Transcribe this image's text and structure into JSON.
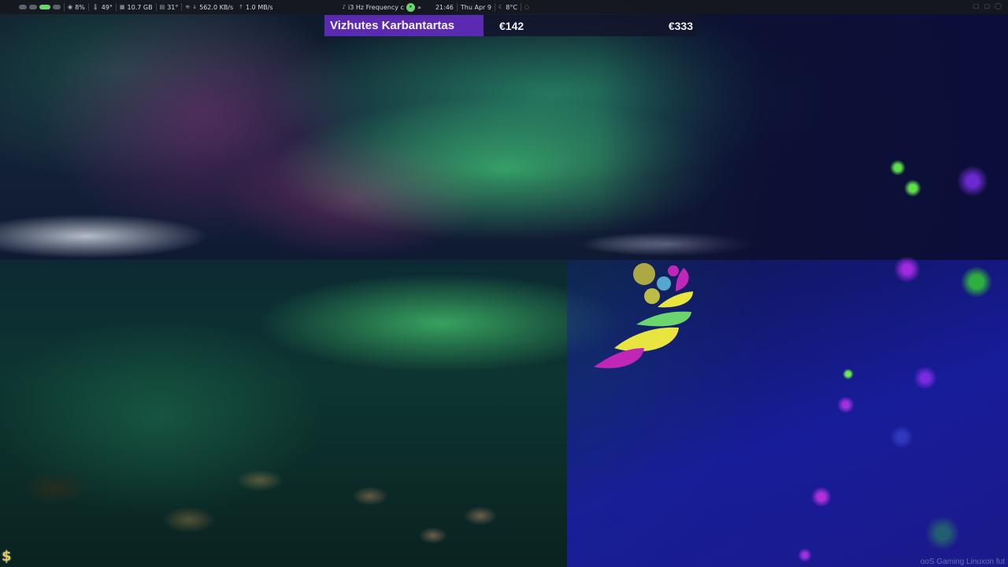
{
  "topbar": {
    "cpu": "8%",
    "cpu_temp": "49°",
    "memory": "10.7 GB",
    "gpu_temp": "31°",
    "net_down": "562.0 KB/s",
    "net_up": "1.0 MB/s",
    "media_title": "i3 Hz Frequency c",
    "media_next": "»",
    "clock": "21:46",
    "date": "Thu Apr 9",
    "weather": "8°C",
    "icons": [
      "cpu-icon",
      "thermometer-icon",
      "memory-icon",
      "gpu-icon",
      "wifi-icon",
      "arrow-down-icon",
      "arrow-up-icon",
      "music-icon",
      "moon-icon"
    ]
  },
  "ticker": {
    "name": "Vizhutes Karbantartas",
    "value_1": "€142",
    "value_2": "€333",
    "accent": "#5a2bb0"
  },
  "bottom": {
    "watermark": "ooS Gaming Linuxon fut",
    "dollar_glyph": "$"
  },
  "colors": {
    "bar_bg": "#16181e",
    "workspace_active": "#6cd66e",
    "aurora_green": "#50ff8c",
    "logo_magenta": "#c026b8",
    "logo_yellow": "#e8e440",
    "logo_green": "#6cd66e"
  }
}
